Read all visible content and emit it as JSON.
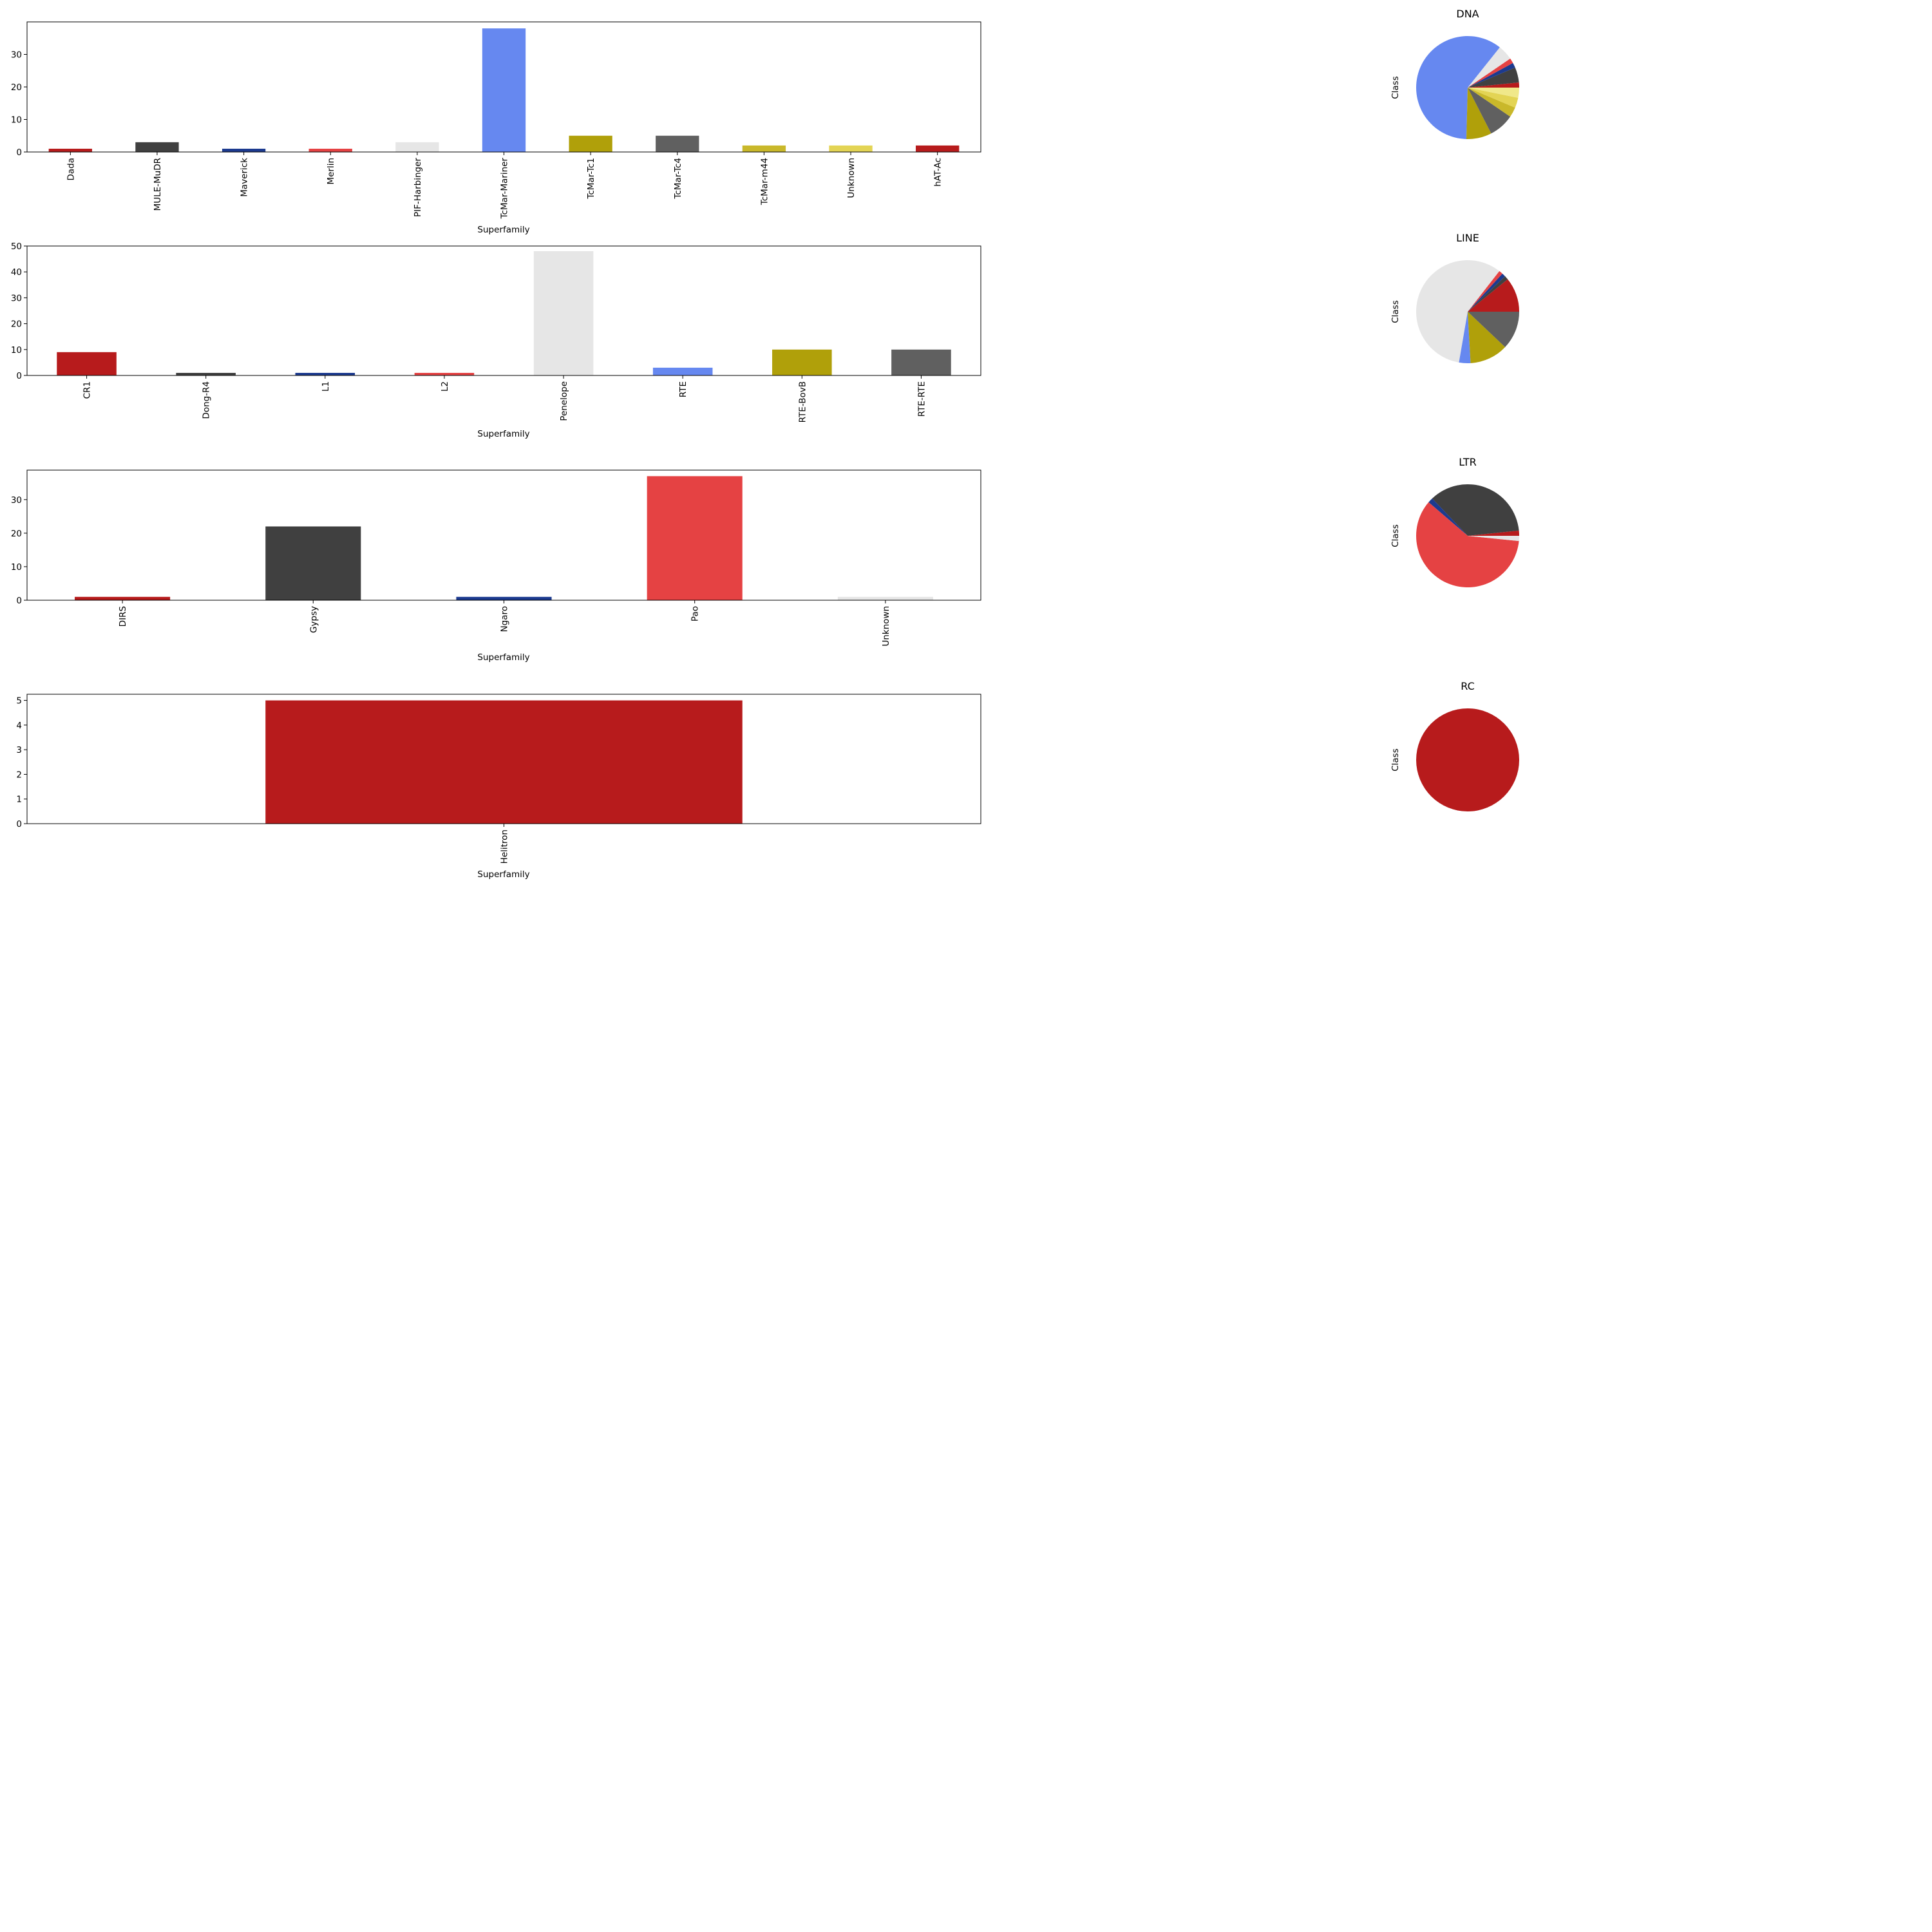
{
  "colors": {
    "red": "#B71B1C",
    "dark_gray": "#404040",
    "navy": "#1C3A8F",
    "light_red": "#E54243",
    "light_gray": "#E6E6E6",
    "blue": "#6688F0",
    "olive": "#B0A00A",
    "mid_gray": "#606060",
    "mustard": "#C9B82A",
    "yellow": "#E3D454",
    "pale_yellow": "#F0E88A"
  },
  "chart_data": [
    {
      "type": "bar",
      "id": "dna-bar",
      "xlabel": "Superfamily",
      "ylabel": "",
      "ylim": [
        0,
        40
      ],
      "yticks": [
        0,
        10,
        20,
        30
      ],
      "categories": [
        "Dada",
        "MULE-MuDR",
        "Maverick",
        "Merlin",
        "PIF-Harbinger",
        "TcMar-Mariner",
        "TcMar-Tc1",
        "TcMar-Tc4",
        "TcMar-m44",
        "Unknown",
        "hAT-Ac"
      ],
      "values": [
        1,
        3,
        1,
        1,
        3,
        38,
        5,
        5,
        2,
        2,
        2
      ],
      "colors": [
        "#B71B1C",
        "#404040",
        "#1C3A8F",
        "#E54243",
        "#E6E6E6",
        "#6688F0",
        "#B0A00A",
        "#606060",
        "#C9B82A",
        "#E3D454",
        "#B71B1C"
      ]
    },
    {
      "type": "bar",
      "id": "line-bar",
      "xlabel": "Superfamily",
      "ylabel": "",
      "ylim": [
        0,
        50
      ],
      "yticks": [
        0,
        10,
        20,
        30,
        40,
        50
      ],
      "categories": [
        "CR1",
        "Dong-R4",
        "L1",
        "L2",
        "Penelope",
        "RTE",
        "RTE-BovB",
        "RTE-RTE"
      ],
      "values": [
        9,
        1,
        1,
        1,
        48,
        3,
        10,
        10
      ],
      "colors": [
        "#B71B1C",
        "#404040",
        "#1C3A8F",
        "#E54243",
        "#E6E6E6",
        "#6688F0",
        "#B0A00A",
        "#606060"
      ]
    },
    {
      "type": "bar",
      "id": "ltr-bar",
      "xlabel": "Superfamily",
      "ylabel": "",
      "ylim": [
        0,
        38.8
      ],
      "yticks": [
        0,
        10,
        20,
        30
      ],
      "categories": [
        "DIRS",
        "Gypsy",
        "Ngaro",
        "Pao",
        "Unknown"
      ],
      "values": [
        1,
        22,
        1,
        37,
        1
      ],
      "colors": [
        "#B71B1C",
        "#404040",
        "#1C3A8F",
        "#E54243",
        "#E6E6E6"
      ]
    },
    {
      "type": "bar",
      "id": "rc-bar",
      "xlabel": "Superfamily",
      "ylabel": "",
      "ylim": [
        0,
        5.25
      ],
      "yticks": [
        0,
        1,
        2,
        3,
        4,
        5
      ],
      "categories": [
        "Helitron"
      ],
      "values": [
        5
      ],
      "colors": [
        "#B71B1C"
      ]
    },
    {
      "type": "pie",
      "id": "dna-pie",
      "title": "DNA",
      "ylabel": "Class",
      "values": [
        1,
        3,
        1,
        1,
        3,
        38,
        5,
        5,
        2,
        2,
        2
      ],
      "colors": [
        "#B71B1C",
        "#404040",
        "#1C3A8F",
        "#E54243",
        "#E6E6E6",
        "#6688F0",
        "#B0A00A",
        "#606060",
        "#C9B82A",
        "#E3D454",
        "#F0E88A"
      ]
    },
    {
      "type": "pie",
      "id": "line-pie",
      "title": "LINE",
      "ylabel": "Class",
      "values": [
        9,
        1,
        1,
        1,
        48,
        3,
        10,
        10
      ],
      "colors": [
        "#B71B1C",
        "#404040",
        "#1C3A8F",
        "#E54243",
        "#E6E6E6",
        "#6688F0",
        "#B0A00A",
        "#606060"
      ]
    },
    {
      "type": "pie",
      "id": "ltr-pie",
      "title": "LTR",
      "ylabel": "Class",
      "values": [
        1,
        22,
        1,
        37,
        1
      ],
      "colors": [
        "#B71B1C",
        "#404040",
        "#1C3A8F",
        "#E54243",
        "#E6E6E6"
      ]
    },
    {
      "type": "pie",
      "id": "rc-pie",
      "title": "RC",
      "ylabel": "Class",
      "values": [
        5
      ],
      "colors": [
        "#B71B1C"
      ]
    }
  ]
}
